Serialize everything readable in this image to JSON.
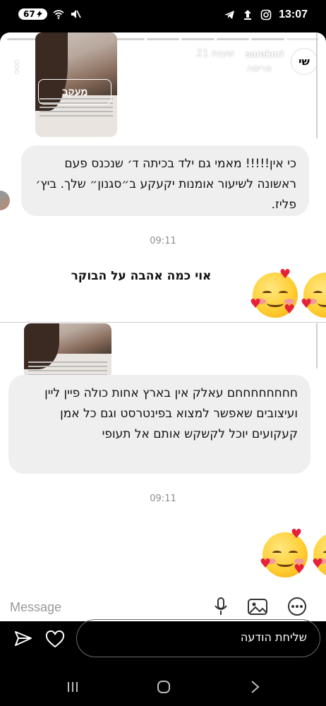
{
  "status_bar": {
    "battery": "67",
    "time": "13:07"
  },
  "story": {
    "username": "sarakori",
    "time_ago": "21 שעות",
    "location": "פריסה",
    "avatar_text": "שי",
    "follow_label": "מעקב"
  },
  "thread": {
    "message1": "כי אין!!!!! מאמי גם ילד בכיתה ד׳ שנכנס פעם ראשונה לשיעור אומנות יקעקע ב״סגנון״ שלך. ביץ׳ פליז.",
    "timestamp1": "09:11",
    "sticker_caption": "אוי כמה אהבה על הבוקר",
    "message2": "חחחחחחחחם עאלק אין בארץ אחות כולה פיין ליין ועיצובים שאפשר למצוא בפינטרסט וגם כל אמן קעקועים יוכל לקשקש אותם אל תעופי",
    "timestamp2": "09:11",
    "message_placeholder": "Message"
  },
  "reply_bar": {
    "placeholder": "שליחת הודעה"
  },
  "icons": [
    "telegram-icon",
    "upload-icon",
    "instagram-icon",
    "wifi-icon",
    "mute-icon",
    "send-icon",
    "heart-icon",
    "mic-icon",
    "gallery-icon",
    "more-icon"
  ],
  "colors": {
    "accent_heart": "#e8213b",
    "bubble_bg": "#efefef"
  }
}
